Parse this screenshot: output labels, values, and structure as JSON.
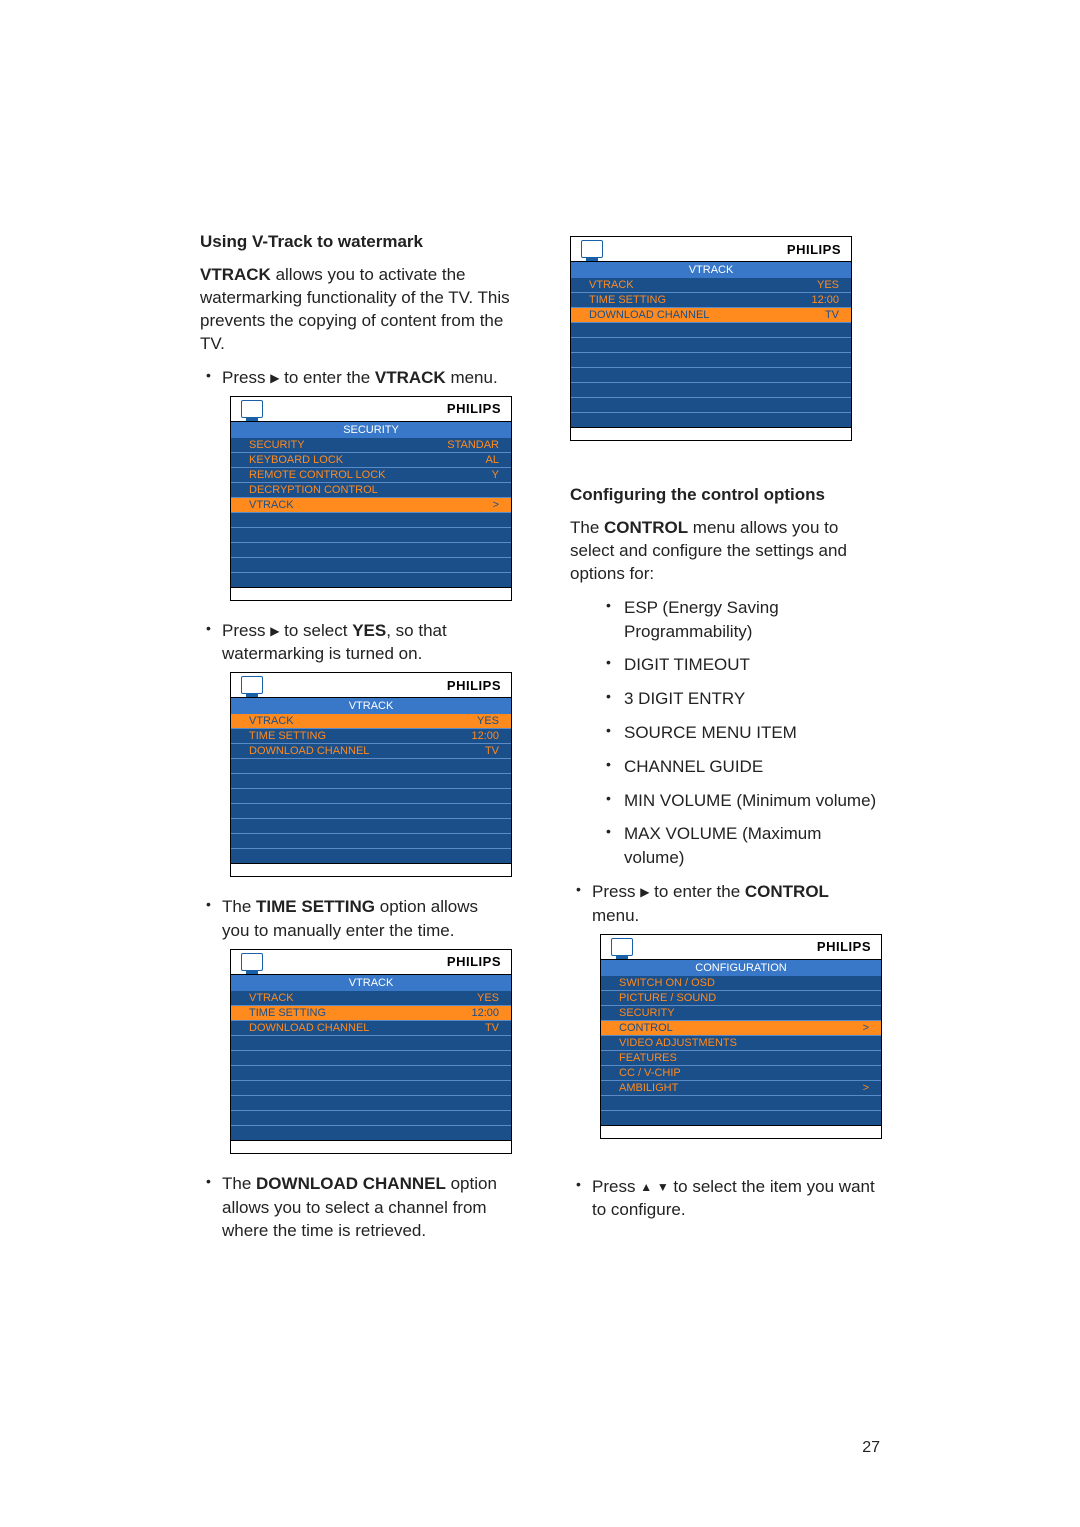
{
  "page_number": "27",
  "brand": "PHILIPS",
  "left": {
    "heading": "Using V-Track to watermark",
    "para1_a": "VTRACK",
    "para1_b": " allows you to activate the watermarking functionality of the TV. This prevents the copying of content from the TV.",
    "bullet1_a": "Press ",
    "bullet1_b": " to enter the ",
    "bullet1_c": "VTRACK",
    "bullet1_d": " menu.",
    "bullet2_a": "Press ",
    "bullet2_b": " to select ",
    "bullet2_c": "YES",
    "bullet2_d": ", so that watermarking is turned on.",
    "bullet3_a": "The ",
    "bullet3_b": "TIME SETTING",
    "bullet3_c": " option allows you to manually enter the time.",
    "bullet4_a": "The ",
    "bullet4_b": "DOWNLOAD CHANNEL",
    "bullet4_c": " option allows you to select a channel from where the time is retrieved."
  },
  "right": {
    "heading": "Conﬁguring the control options",
    "para1_a": "The ",
    "para1_b": "CONTROL",
    "para1_c": " menu allows you to select and configure the settings and options for:",
    "items": {
      "i1": "ESP (Energy Saving Programmability)",
      "i2": "DIGIT TIMEOUT",
      "i3": "3 DIGIT ENTRY",
      "i4": "SOURCE MENU ITEM",
      "i5": "CHANNEL GUIDE",
      "i6a": "MIN VOLUME",
      "i6b": " (Minimum volume)",
      "i7a": "MAX VOLUME",
      "i7b": " (Maximum volume)"
    },
    "bullet1_a": "Press ",
    "bullet1_b": " to enter the ",
    "bullet1_c": "CONTROL",
    "bullet1_d": " menu.",
    "bullet2_a": "Press ",
    "bullet2_b": " to select the item you want to configure."
  },
  "osd1": {
    "title": "SECURITY",
    "rows": [
      {
        "label": "SECURITY",
        "value": "STANDAR",
        "sel": false
      },
      {
        "label": "KEYBOARD LOCK",
        "value": "AL",
        "sel": false
      },
      {
        "label": "REMOTE CONTROL LOCK",
        "value": "Y",
        "sel": false
      },
      {
        "label": "DECRYPTION CONTROL",
        "value": "",
        "sel": false
      },
      {
        "label": "VTRACK",
        "value": ">",
        "sel": true
      }
    ]
  },
  "osd2": {
    "title": "VTRACK",
    "rows": [
      {
        "label": "VTRACK",
        "value": "YES",
        "sel": true
      },
      {
        "label": "TIME SETTING",
        "value": "12:00",
        "sel": false
      },
      {
        "label": "DOWNLOAD CHANNEL",
        "value": "TV",
        "sel": false
      }
    ]
  },
  "osd3": {
    "title": "VTRACK",
    "rows": [
      {
        "label": "VTRACK",
        "value": "YES",
        "sel": false
      },
      {
        "label": "TIME SETTING",
        "value": "12:00",
        "sel": true
      },
      {
        "label": "DOWNLOAD CHANNEL",
        "value": "TV",
        "sel": false
      }
    ]
  },
  "osd4": {
    "title": "VTRACK",
    "rows": [
      {
        "label": "VTRACK",
        "value": "YES",
        "sel": false
      },
      {
        "label": "TIME SETTING",
        "value": "12:00",
        "sel": false
      },
      {
        "label": "DOWNLOAD CHANNEL",
        "value": "TV",
        "sel": true
      }
    ]
  },
  "osd5": {
    "title": "CONFIGURATION",
    "rows": [
      {
        "label": "SWITCH ON / OSD",
        "value": "",
        "sel": false
      },
      {
        "label": "PICTURE  /  SOUND",
        "value": "",
        "sel": false
      },
      {
        "label": "SECURITY",
        "value": "",
        "sel": false
      },
      {
        "label": "CONTROL",
        "value": ">",
        "sel": true
      },
      {
        "label": "VIDEO ADJUSTMENTS",
        "value": "",
        "sel": false
      },
      {
        "label": "FEATURES",
        "value": "",
        "sel": false
      },
      {
        "label": "CC / V-CHIP",
        "value": "",
        "sel": false
      },
      {
        "label": "AMBILIGHT",
        "value": ">",
        "sel": false
      }
    ]
  }
}
